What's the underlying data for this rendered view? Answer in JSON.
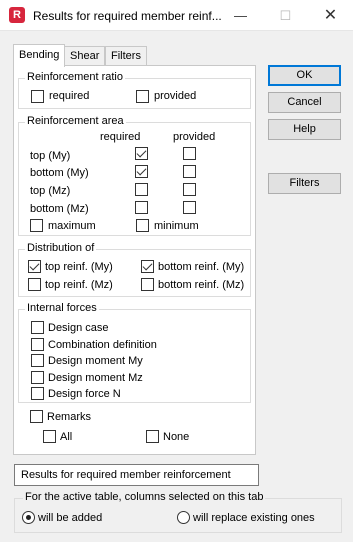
{
  "window": {
    "title": "Results for required member reinf...",
    "app_icon_letter": "R",
    "minimize_glyph": "—",
    "maximize_glyph": "☐",
    "close_glyph": "✕"
  },
  "tabs": [
    {
      "label": "Bending",
      "active": true
    },
    {
      "label": "Shear",
      "active": false
    },
    {
      "label": "Filters",
      "active": false
    }
  ],
  "reinforcement_ratio": {
    "title": "Reinforcement ratio",
    "required": {
      "label": "required",
      "checked": false
    },
    "provided": {
      "label": "provided",
      "checked": false
    }
  },
  "reinforcement_area": {
    "title": "Reinforcement area",
    "col_required": "required",
    "col_provided": "provided",
    "rows": [
      {
        "label": "top (My)",
        "required": true,
        "provided": false
      },
      {
        "label": "bottom (My)",
        "required": true,
        "provided": false
      },
      {
        "label": "top (Mz)",
        "required": false,
        "provided": false
      },
      {
        "label": "bottom (Mz)",
        "required": false,
        "provided": false
      }
    ],
    "maximum": {
      "label": "maximum",
      "checked": false
    },
    "minimum": {
      "label": "minimum",
      "checked": false
    }
  },
  "distribution": {
    "title": "Distribution of",
    "top_my": {
      "label": "top reinf. (My)",
      "checked": true
    },
    "bottom_my": {
      "label": "bottom reinf. (My)",
      "checked": true
    },
    "top_mz": {
      "label": "top reinf. (Mz)",
      "checked": false
    },
    "bottom_mz": {
      "label": "bottom reinf. (Mz)",
      "checked": false
    }
  },
  "internal_forces": {
    "title": "Internal forces",
    "items": [
      {
        "label": "Design case",
        "checked": false
      },
      {
        "label": "Combination definition",
        "checked": false
      },
      {
        "label": "Design moment My",
        "checked": false
      },
      {
        "label": "Design moment Mz",
        "checked": false
      },
      {
        "label": "Design force N",
        "checked": false
      }
    ]
  },
  "remarks": {
    "label": "Remarks",
    "checked": false,
    "all": {
      "label": "All",
      "checked": false
    },
    "none": {
      "label": "None",
      "checked": false
    }
  },
  "buttons": {
    "ok": "OK",
    "cancel": "Cancel",
    "help": "Help",
    "filters": "Filters"
  },
  "table_name": "Results for required member reinforcement",
  "columns_option": {
    "title": "For the active table, columns selected on this tab",
    "added": {
      "label": "will be added",
      "selected": true
    },
    "replace": {
      "label": "will replace existing ones",
      "selected": false
    }
  }
}
